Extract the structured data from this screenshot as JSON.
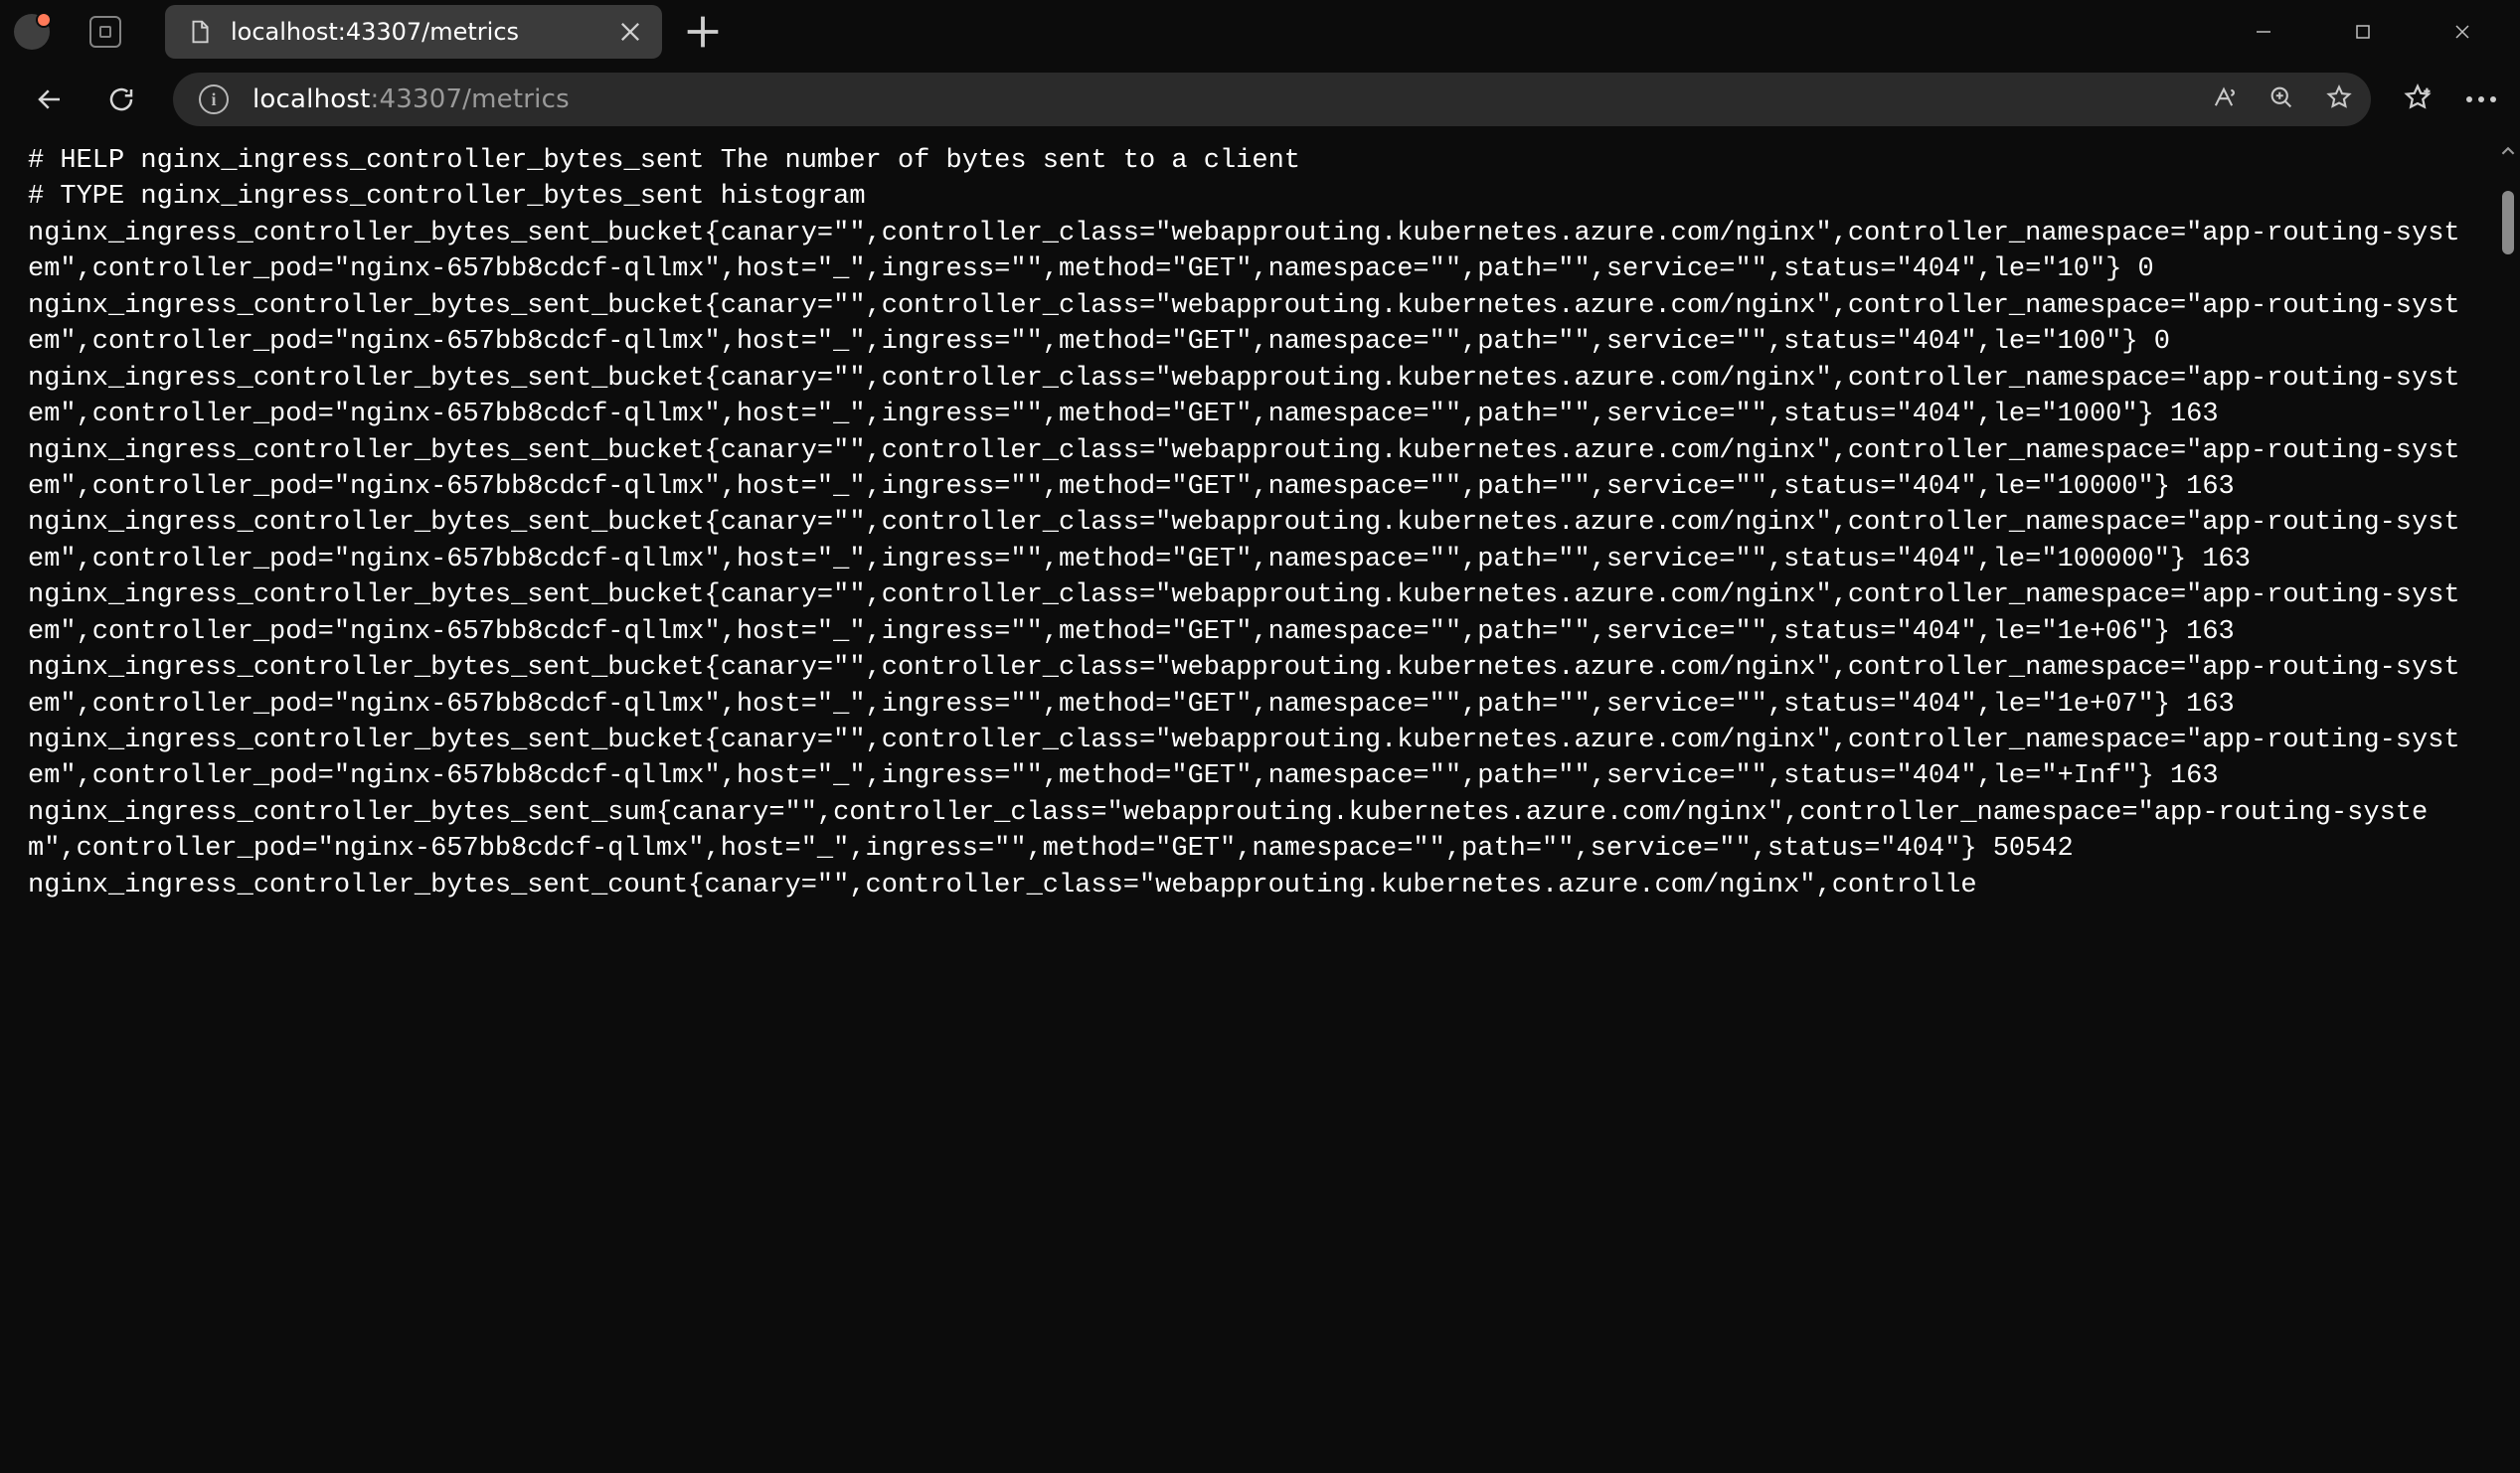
{
  "window": {
    "tab_title": "localhost:43307/metrics"
  },
  "address": {
    "host": "localhost",
    "rest": ":43307/metrics"
  },
  "metrics": {
    "metric_name": "nginx_ingress_controller_bytes_sent",
    "help_line": "# HELP nginx_ingress_controller_bytes_sent The number of bytes sent to a client",
    "type_line": "# TYPE nginx_ingress_controller_bytes_sent histogram",
    "labels": {
      "canary": "",
      "controller_class": "webapprouting.kubernetes.azure.com/nginx",
      "controller_namespace": "app-routing-system",
      "controller_pod": "nginx-657bb8cdcf-qllmx",
      "host": "_",
      "ingress": "",
      "method": "GET",
      "namespace": "",
      "path": "",
      "service": "",
      "status": "404"
    },
    "buckets": [
      {
        "le": "10",
        "value": 0
      },
      {
        "le": "100",
        "value": 0
      },
      {
        "le": "1000",
        "value": 163
      },
      {
        "le": "10000",
        "value": 163
      },
      {
        "le": "100000",
        "value": 163
      },
      {
        "le": "1e+06",
        "value": 163
      },
      {
        "le": "1e+07",
        "value": 163
      },
      {
        "le": "+Inf",
        "value": 163
      }
    ],
    "sum": 50542,
    "count_prefix_visible": "nginx_ingress_controller_bytes_sent_count{canary=\"\",controller_class=\"webapprouting.kubernetes.azure.com/nginx\",controlle"
  }
}
